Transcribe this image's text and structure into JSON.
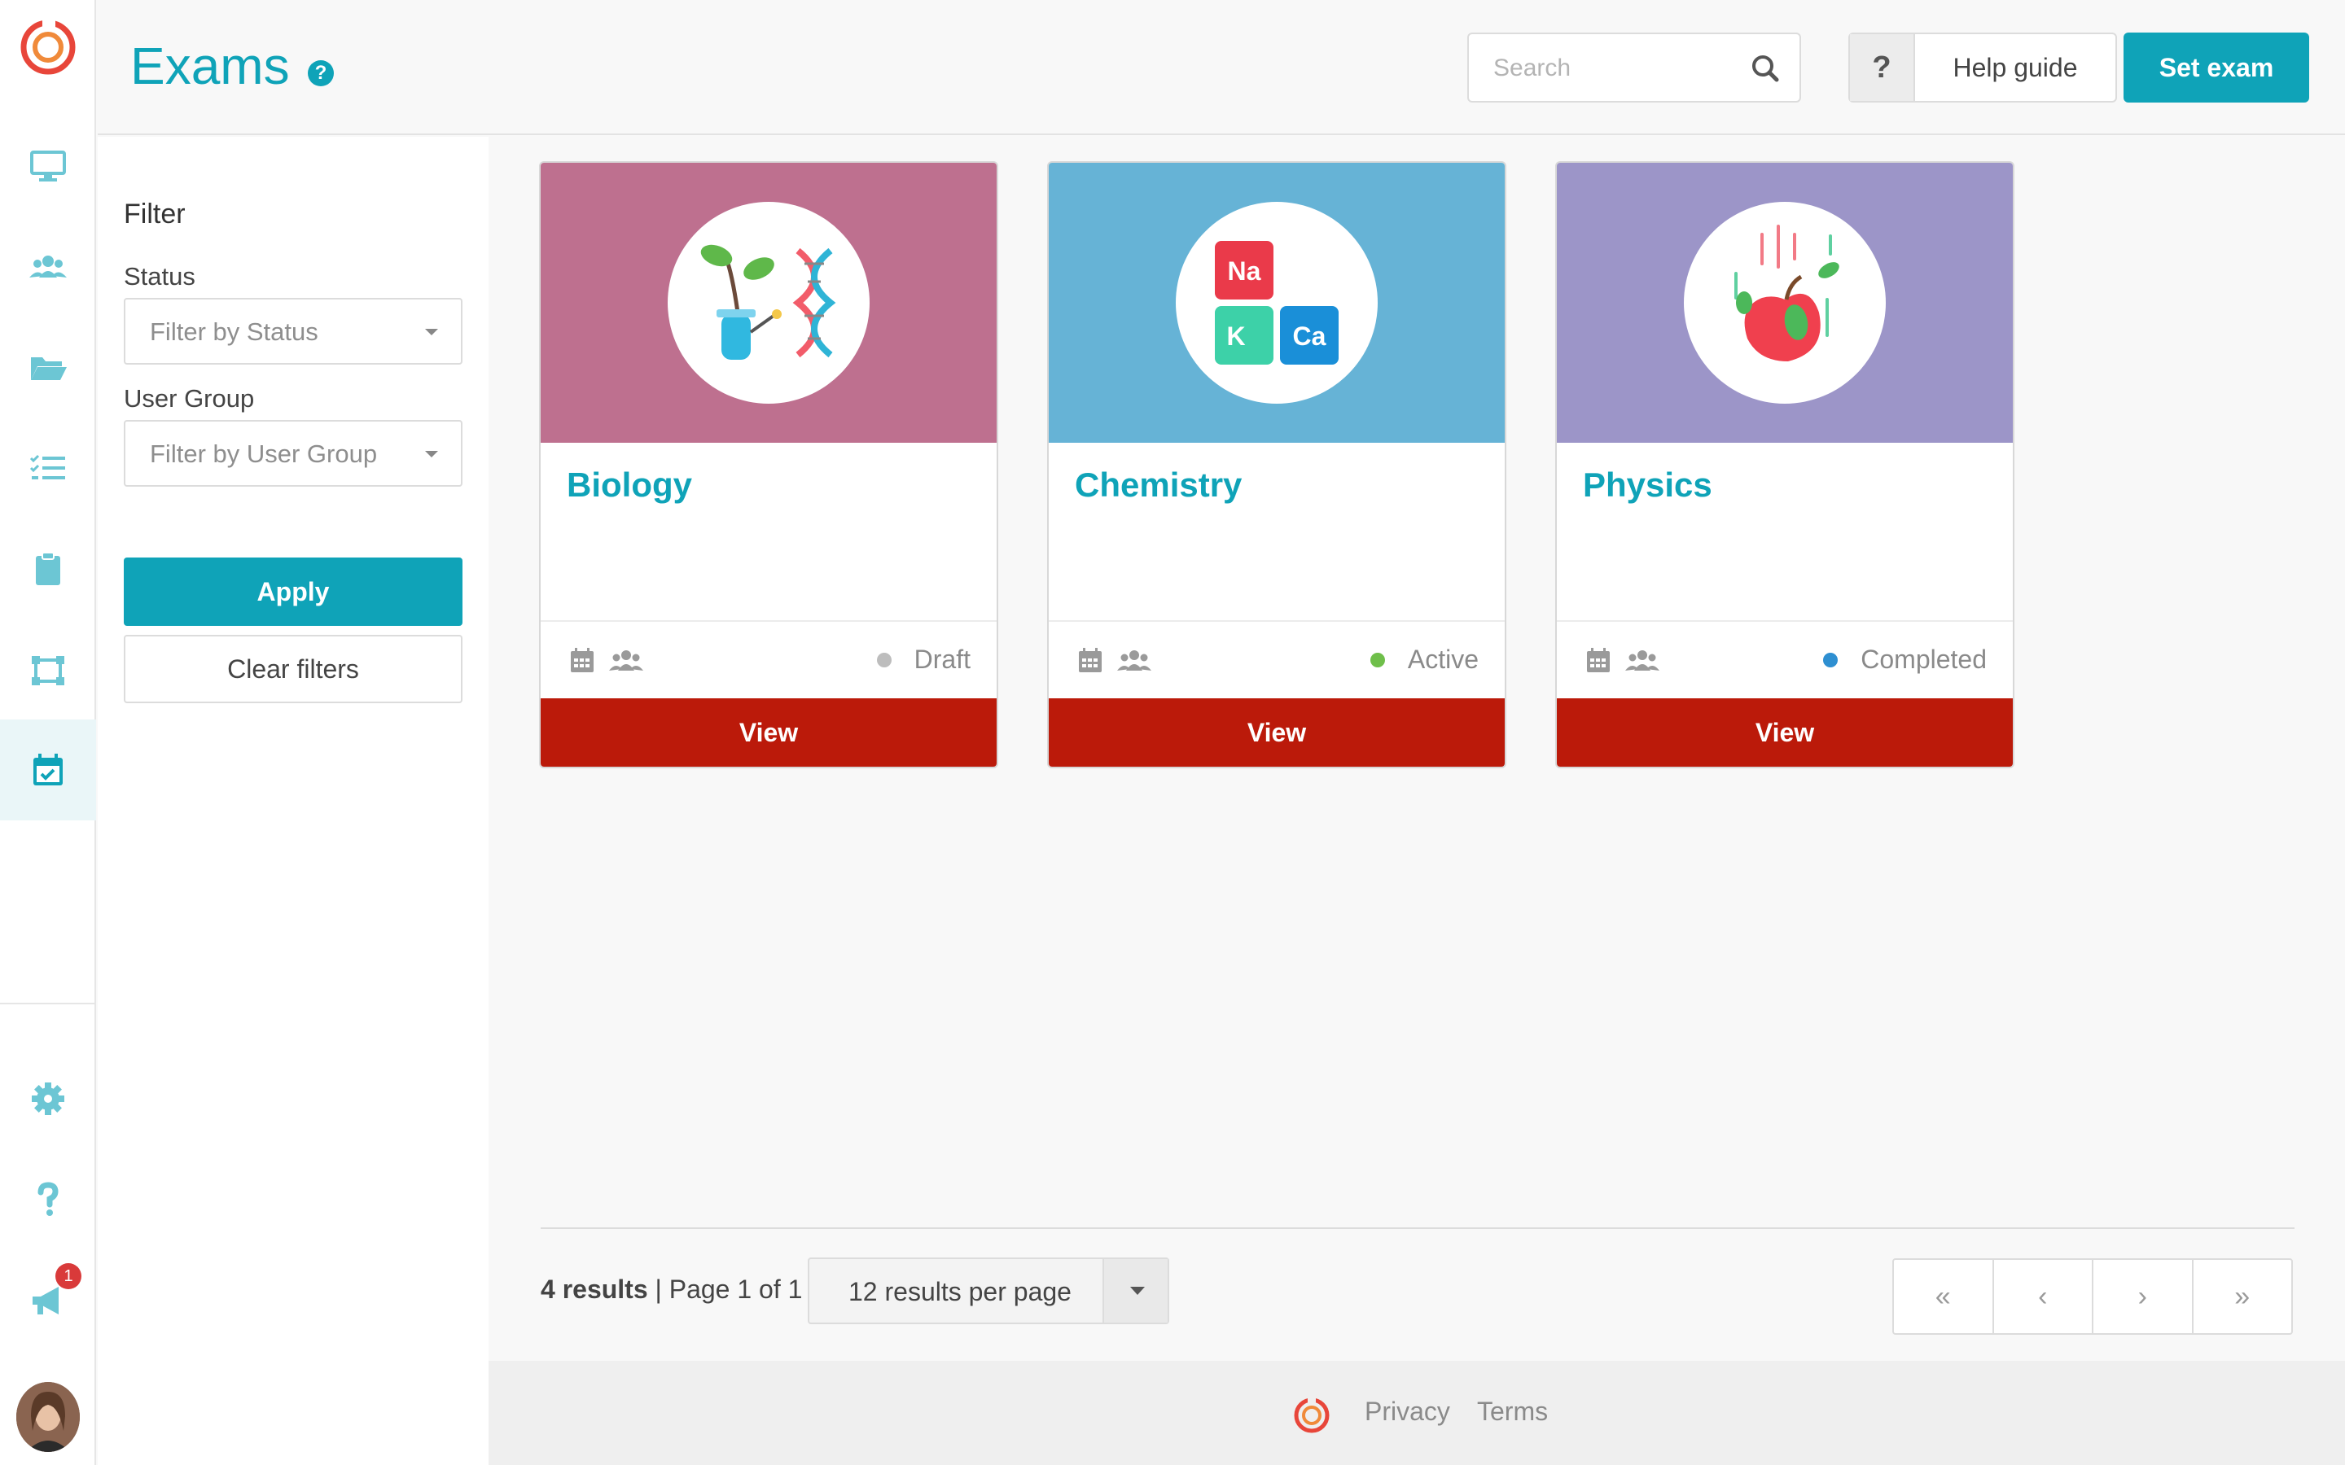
{
  "header": {
    "title": "Exams",
    "search_placeholder": "Search",
    "help_label": "Help guide",
    "help_icon_text": "?",
    "set_exam_label": "Set exam"
  },
  "rail": {
    "items": [
      "monitor-icon",
      "users-icon",
      "folder-icon",
      "checklist-icon",
      "clipboard-icon",
      "crop-icon",
      "calendar-check-icon"
    ],
    "bottom_items": [
      "gear-icon",
      "question-icon",
      "megaphone-icon"
    ],
    "notification_count": "1",
    "active_item": "calendar-check-icon"
  },
  "filter": {
    "title": "Filter",
    "status_label": "Status",
    "status_placeholder": "Filter by Status",
    "group_label": "User Group",
    "group_placeholder": "Filter by User Group",
    "apply_label": "Apply",
    "clear_label": "Clear filters"
  },
  "cards": [
    {
      "title": "Biology",
      "status": "Draft",
      "status_color": "#bdbdbd",
      "banner_color": "#be708f",
      "button": "View"
    },
    {
      "title": "Chemistry",
      "status": "Active",
      "status_color": "#6fbf4a",
      "banner_color": "#66b3d6",
      "button": "View"
    },
    {
      "title": "Physics",
      "status": "Completed",
      "status_color": "#2e8fd1",
      "banner_color": "#9c95c8",
      "button": "View"
    }
  ],
  "chem_icons": {
    "na": "Na",
    "k": "K",
    "ca": "Ca"
  },
  "results": {
    "count": "4 results",
    "page": "| Page 1 of 1",
    "per_page": "12 results per page"
  },
  "pager": {
    "first": "«",
    "prev": "‹",
    "next": "›",
    "last": "»"
  },
  "footer": {
    "privacy": "Privacy",
    "terms": "Terms"
  },
  "colors": {
    "accent": "#0fa3b8",
    "view_button": "#bb1a0a",
    "logo": "#e8463a"
  }
}
